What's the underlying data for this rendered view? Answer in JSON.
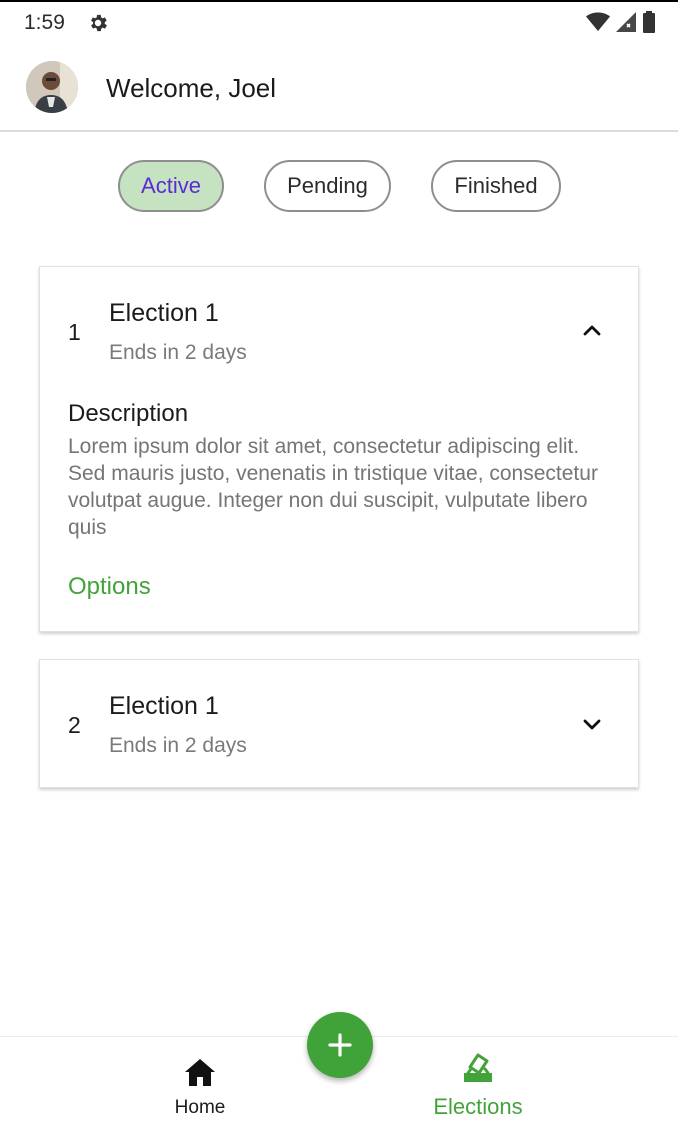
{
  "status_bar": {
    "time": "1:59"
  },
  "header": {
    "welcome_text": "Welcome, Joel"
  },
  "filters": [
    {
      "label": "Active",
      "selected": true
    },
    {
      "label": "Pending",
      "selected": false
    },
    {
      "label": "Finished",
      "selected": false
    }
  ],
  "elections": [
    {
      "index": "1",
      "title": "Election 1",
      "subtitle": "Ends in 2 days",
      "expanded": true,
      "description_heading": "Description",
      "description": "Lorem ipsum dolor sit amet, consectetur adipiscing elit. Sed mauris justo, venenatis in tristique vitae, consectetur volutpat augue. Integer non dui suscipit, vulputate libero quis",
      "options_label": "Options"
    },
    {
      "index": "2",
      "title": "Election 1",
      "subtitle": "Ends in 2 days",
      "expanded": false
    }
  ],
  "bottom_nav": {
    "home_label": "Home",
    "elections_label": "Elections",
    "active_tab": "Elections"
  },
  "colors": {
    "accent_green": "#43a33b",
    "chip_active_bg": "#c5e2c1",
    "chip_active_text": "#5b2bd6",
    "fab": "#3fa33a"
  },
  "icons": {
    "status": [
      "gear-icon",
      "wifi-icon",
      "signal-icon",
      "battery-icon"
    ],
    "card_toggle": [
      "chevron-up-icon",
      "chevron-down-icon"
    ],
    "nav": [
      "home-icon",
      "ballot-box-icon"
    ],
    "fab": "plus-icon"
  }
}
